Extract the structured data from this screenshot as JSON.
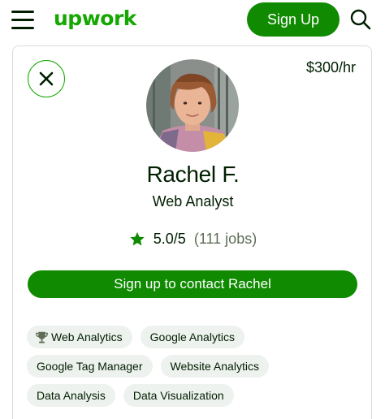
{
  "header": {
    "logo_text": "upwork",
    "signup_label": "Sign Up",
    "menu_icon": "hamburger-menu-icon",
    "search_icon": "search-icon"
  },
  "profile": {
    "rate": "$300/hr",
    "name": "Rachel F.",
    "title": "Web Analyst",
    "rating": "5.0/5",
    "jobs": "(111 jobs)",
    "contact_label": "Sign up to contact Rachel",
    "skills": [
      {
        "label": "Web Analytics",
        "icon": "trophy-icon"
      },
      {
        "label": "Google Analytics"
      },
      {
        "label": "Google Tag Manager"
      },
      {
        "label": "Website Analytics"
      },
      {
        "label": "Data Analysis"
      },
      {
        "label": "Data Visualization"
      }
    ]
  },
  "colors": {
    "brand_green": "#14a800",
    "button_green": "#108a00",
    "text": "#001e00",
    "chip_bg": "#eef2ee"
  }
}
